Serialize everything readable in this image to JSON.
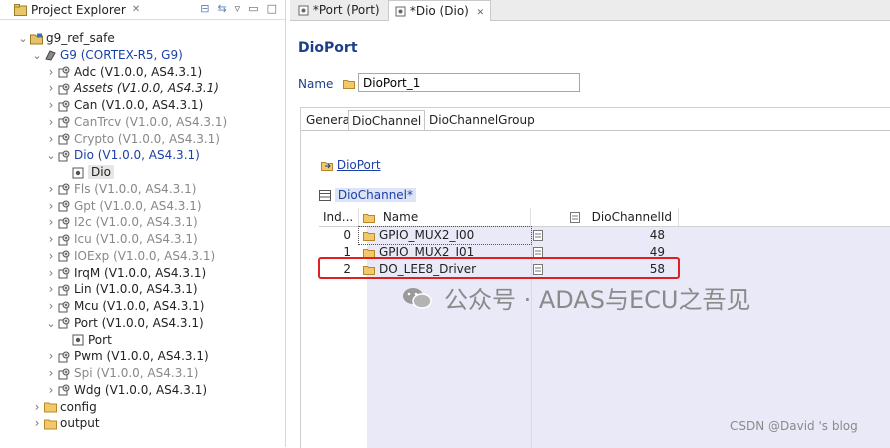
{
  "explorer": {
    "title": "Project Explorer",
    "items": [
      {
        "label": "g9_ref_safe",
        "depth": 0,
        "twisty": "open",
        "icon": "project-icon",
        "style": "normal"
      },
      {
        "label": "G9 (CORTEX-R5, G9)",
        "depth": 1,
        "twisty": "open",
        "icon": "ecu-icon",
        "style": "blue"
      },
      {
        "label": "Adc (V1.0.0, AS4.3.1)",
        "depth": 2,
        "twisty": "closed",
        "icon": "module-icon",
        "style": "normal"
      },
      {
        "label": "Assets (V1.0.0, AS4.3.1)",
        "depth": 2,
        "twisty": "closed",
        "icon": "module-icon",
        "style": "italic"
      },
      {
        "label": "Can (V1.0.0, AS4.3.1)",
        "depth": 2,
        "twisty": "closed",
        "icon": "module-icon",
        "style": "normal"
      },
      {
        "label": "CanTrcv (V1.0.0, AS4.3.1)",
        "depth": 2,
        "twisty": "closed",
        "icon": "module-icon",
        "style": "gray"
      },
      {
        "label": "Crypto (V1.0.0, AS4.3.1)",
        "depth": 2,
        "twisty": "closed",
        "icon": "module-icon",
        "style": "gray"
      },
      {
        "label": "Dio (V1.0.0, AS4.3.1)",
        "depth": 2,
        "twisty": "open",
        "icon": "module-icon",
        "style": "blue"
      },
      {
        "label": "Dio",
        "depth": 3,
        "twisty": "none",
        "icon": "config-icon",
        "style": "selected"
      },
      {
        "label": "Fls (V1.0.0, AS4.3.1)",
        "depth": 2,
        "twisty": "closed",
        "icon": "module-icon",
        "style": "gray"
      },
      {
        "label": "Gpt (V1.0.0, AS4.3.1)",
        "depth": 2,
        "twisty": "closed",
        "icon": "module-icon",
        "style": "gray"
      },
      {
        "label": "I2c (V1.0.0, AS4.3.1)",
        "depth": 2,
        "twisty": "closed",
        "icon": "module-icon",
        "style": "gray"
      },
      {
        "label": "Icu (V1.0.0, AS4.3.1)",
        "depth": 2,
        "twisty": "closed",
        "icon": "module-icon",
        "style": "gray"
      },
      {
        "label": "IOExp (V1.0.0, AS4.3.1)",
        "depth": 2,
        "twisty": "closed",
        "icon": "module-icon",
        "style": "gray"
      },
      {
        "label": "IrqM (V1.0.0, AS4.3.1)",
        "depth": 2,
        "twisty": "closed",
        "icon": "module-icon",
        "style": "normal"
      },
      {
        "label": "Lin (V1.0.0, AS4.3.1)",
        "depth": 2,
        "twisty": "closed",
        "icon": "module-icon",
        "style": "normal"
      },
      {
        "label": "Mcu (V1.0.0, AS4.3.1)",
        "depth": 2,
        "twisty": "closed",
        "icon": "module-icon",
        "style": "normal"
      },
      {
        "label": "Port (V1.0.0, AS4.3.1)",
        "depth": 2,
        "twisty": "open",
        "icon": "module-icon",
        "style": "normal"
      },
      {
        "label": "Port",
        "depth": 3,
        "twisty": "none",
        "icon": "config-icon",
        "style": "normal"
      },
      {
        "label": "Pwm (V1.0.0, AS4.3.1)",
        "depth": 2,
        "twisty": "closed",
        "icon": "module-icon",
        "style": "normal"
      },
      {
        "label": "Spi (V1.0.0, AS4.3.1)",
        "depth": 2,
        "twisty": "closed",
        "icon": "module-icon",
        "style": "gray"
      },
      {
        "label": "Wdg (V1.0.0, AS4.3.1)",
        "depth": 2,
        "twisty": "closed",
        "icon": "module-icon",
        "style": "normal"
      },
      {
        "label": "config",
        "depth": 1,
        "twisty": "closed",
        "icon": "folder-icon",
        "style": "normal"
      },
      {
        "label": "output",
        "depth": 1,
        "twisty": "closed",
        "icon": "folder-icon",
        "style": "normal"
      }
    ]
  },
  "editor": {
    "tabs": [
      {
        "label": "*Port (Port)",
        "active": false
      },
      {
        "label": "*Dio (Dio)",
        "active": true
      }
    ],
    "title": "DioPort",
    "name_label": "Name",
    "name_value": "DioPort_1",
    "inner_tabs": [
      "General",
      "DioChannel",
      "DioChannelGroup"
    ],
    "breadcrumb": "DioPort",
    "section_label": "DioChannel*",
    "columns": [
      "Ind...",
      "Name",
      "DioChannelId"
    ],
    "rows": [
      {
        "index": "0",
        "name": "GPIO_MUX2_I00",
        "id": "48"
      },
      {
        "index": "1",
        "name": "GPIO_MUX2_I01",
        "id": "49"
      },
      {
        "index": "2",
        "name": "DO_LEE8_Driver",
        "id": "58"
      }
    ]
  },
  "watermark": "公众号 · ADAS与ECU之吾见",
  "credit": "CSDN @David 's blog",
  "colors": {
    "accent": "#1b3f8b",
    "highlight": "#e02020",
    "grid_shade": "#e9e9f8"
  }
}
